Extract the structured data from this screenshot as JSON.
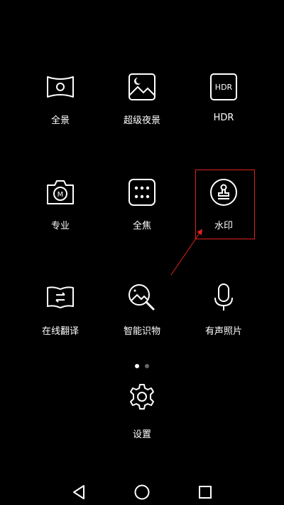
{
  "modes": [
    {
      "label": "全景",
      "icon": "panorama-icon"
    },
    {
      "label": "超级夜景",
      "icon": "night-mode-icon"
    },
    {
      "label": "HDR",
      "icon": "hdr-icon",
      "icon_text": "HDR"
    },
    {
      "label": "专业",
      "icon": "pro-camera-icon",
      "icon_text": "M"
    },
    {
      "label": "全焦",
      "icon": "all-focus-icon"
    },
    {
      "label": "水印",
      "icon": "watermark-stamp-icon"
    },
    {
      "label": "在线翻译",
      "icon": "translate-book-icon"
    },
    {
      "label": "智能识物",
      "icon": "smart-recognition-icon"
    },
    {
      "label": "有声照片",
      "icon": "microphone-icon"
    }
  ],
  "pager": {
    "active_index": 0,
    "count": 2
  },
  "settings": {
    "label": "设置",
    "icon": "gear-icon"
  },
  "annotation": {
    "highlight_color": "#e02020",
    "target": "水印"
  },
  "navbar": {
    "back": "back-triangle-icon",
    "home": "home-circle-icon",
    "recents": "recents-square-icon"
  },
  "colors": {
    "background": "#000000",
    "foreground": "#ffffff",
    "dot_inactive": "#666666"
  }
}
